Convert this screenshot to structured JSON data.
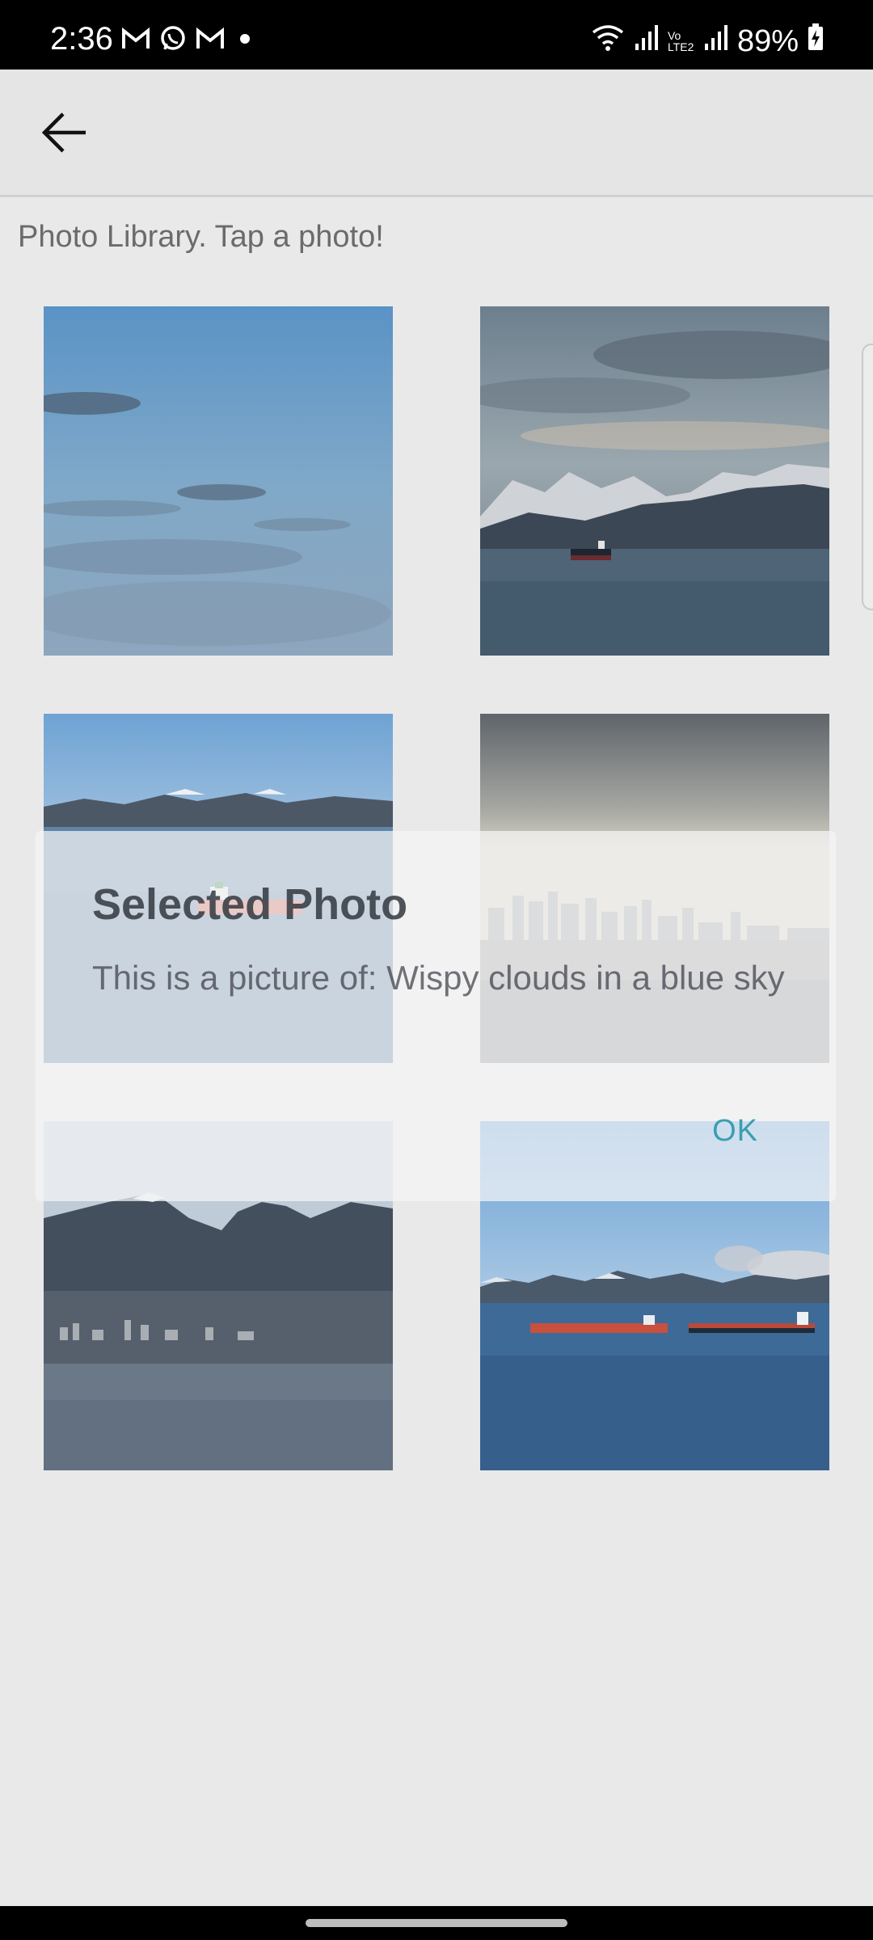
{
  "status_bar": {
    "time": "2:36",
    "battery_percent": "89%",
    "left_icons": [
      "gmail-icon",
      "whatsapp-icon",
      "gmail-icon",
      "dot-icon"
    ],
    "right_icons": [
      "wifi-icon",
      "signal-icon",
      "volte-icon",
      "signal-icon",
      "battery-charging-icon"
    ],
    "volte_text": "Vo LTE2"
  },
  "app_bar": {
    "back_icon": "arrow-back-icon"
  },
  "library": {
    "hint": "Photo Library. Tap a photo!",
    "photos": [
      {
        "subject": "Wispy clouds in a blue sky"
      },
      {
        "subject": "Mountains, sea and a ship under clouds"
      },
      {
        "subject": "Red ship on the sea with snowy mountains"
      },
      {
        "subject": "City skyline across the water"
      },
      {
        "subject": "Mountains and city shoreline"
      },
      {
        "subject": "Two ships on the sea with mountains"
      }
    ]
  },
  "dialog": {
    "title": "Selected Photo",
    "message": "This is a picture of: Wispy clouds in a blue sky",
    "ok_label": "OK"
  },
  "colors": {
    "background": "#e9e9ea",
    "accent": "#3a9fb0",
    "status_bar": "#000000"
  }
}
